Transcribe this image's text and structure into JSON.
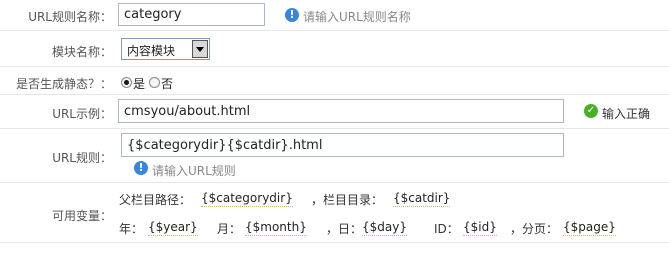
{
  "form": {
    "url_rule_name": {
      "label": "URL规则名称：",
      "value": "category",
      "hint": "请输入URL规则名称"
    },
    "module": {
      "label": "模块名称：",
      "selected": "内容模块"
    },
    "static": {
      "label": "是否生成静态？：",
      "options": [
        "是",
        "否"
      ],
      "selected": "是"
    },
    "url_example": {
      "label": "URL示例：",
      "value": "cmsyou/about.html",
      "status": "输入正确"
    },
    "url_rule": {
      "label": "URL规则：",
      "value": "{$categorydir}{$catdir}.html",
      "hint": "请输入URL规则"
    },
    "variables": {
      "label": "可用变量：",
      "line1": {
        "parent_path_label": "父栏目路径：",
        "parent_path_token": "{$categorydir}",
        "catdir_label": "，栏目目录：",
        "catdir_token": "{$catdir}"
      },
      "line2": {
        "year_label": "年：",
        "year_token": "{$year}",
        "month_label": "月：",
        "month_token": "{$month}",
        "day_label": "，日：",
        "day_token": "{$day}",
        "id_label": "ID：",
        "id_token": "{$id}",
        "page_label": "，分页：",
        "page_token": "{$page}"
      }
    }
  },
  "colors": {
    "info": "#3a85d8",
    "ok": "#4cae2c",
    "border": "#a9b8c8"
  },
  "icons": {
    "info": "info-icon",
    "ok": "check-icon"
  }
}
